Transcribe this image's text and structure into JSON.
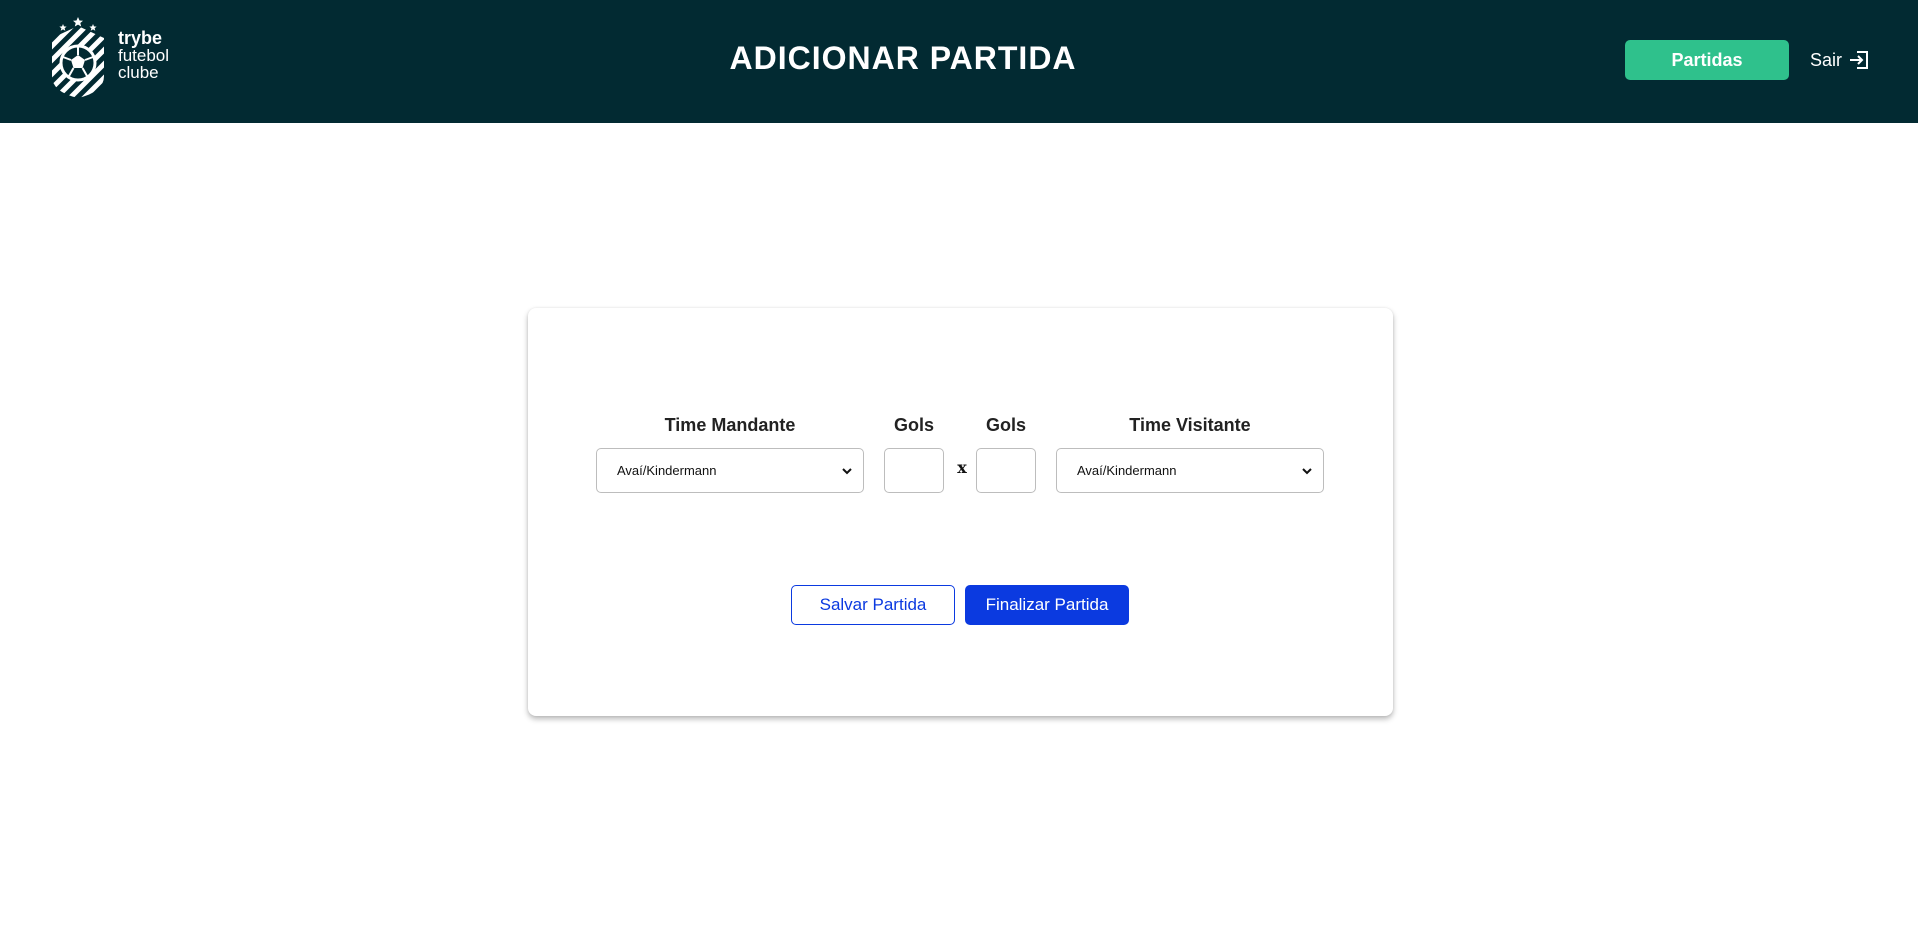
{
  "header": {
    "logo": {
      "line1": "trybe",
      "line2": "futebol",
      "line3": "clube",
      "icon": "soccer-crest-icon"
    },
    "title": "ADICIONAR PARTIDA",
    "nav_button_label": "Partidas",
    "logout_label": "Sair",
    "logout_icon": "logout-arrow-icon"
  },
  "form": {
    "home_team_label": "Time Mandante",
    "home_team_value": "Avaí/Kindermann",
    "home_goals_label": "Gols",
    "home_goals_value": "",
    "separator": "x",
    "away_goals_label": "Gols",
    "away_goals_value": "",
    "away_team_label": "Time Visitante",
    "away_team_value": "Avaí/Kindermann",
    "save_button_label": "Salvar Partida",
    "finish_button_label": "Finalizar Partida"
  },
  "colors": {
    "header_bg": "#022a32",
    "nav_button_bg": "#2fc18c",
    "primary_blue": "#0b3ae0"
  }
}
